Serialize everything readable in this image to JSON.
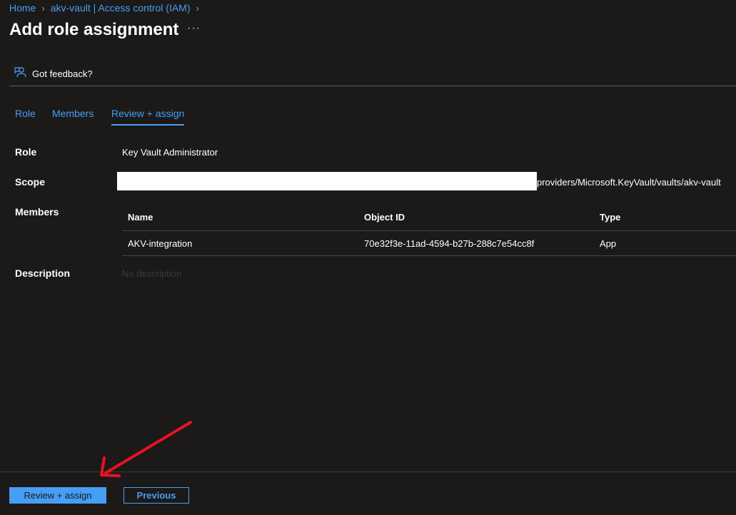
{
  "breadcrumb": {
    "items": [
      "Home",
      "akv-vault | Access control (IAM)"
    ]
  },
  "page_title": "Add role assignment",
  "more_icon": "···",
  "feedback_label": "Got feedback?",
  "tabs": [
    {
      "label": "Role"
    },
    {
      "label": "Members"
    },
    {
      "label": "Review + assign",
      "selected": true
    }
  ],
  "review": {
    "role_label": "Role",
    "role_value": "Key Vault Administrator",
    "scope_label": "Scope",
    "scope_value": "providers/Microsoft.KeyVault/vaults/akv-vault",
    "members_label": "Members",
    "description_label": "Description",
    "description_value": "No description"
  },
  "members_table": {
    "columns": [
      "Name",
      "Object ID",
      "Type"
    ],
    "rows": [
      {
        "name": "AKV-integration",
        "object_id": "70e32f3e-11ad-4594-b27b-288c7e54cc8f",
        "type": "App"
      }
    ]
  },
  "footer": {
    "primary_label": "Review + assign",
    "secondary_label": "Previous"
  },
  "colors": {
    "background": "#1b1a19",
    "accent": "#479ef5",
    "annotation_arrow": "#e81123"
  }
}
